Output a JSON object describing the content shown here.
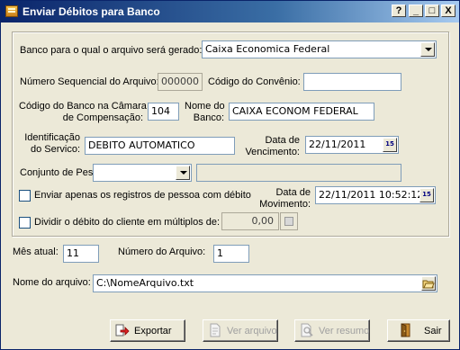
{
  "window": {
    "title": "Enviar Débitos para Banco",
    "controls": {
      "help": "?",
      "minimize": "_",
      "maximize": "□",
      "close": "X"
    }
  },
  "form": {
    "banco_label": "Banco para o qual o arquivo será gerado:",
    "banco_value": "Caixa Economica Federal",
    "sequencial_label": "Número Sequencial do Arquivo:",
    "sequencial_value": "000000",
    "convenio_label": "Código do Convênio:",
    "convenio_value": "",
    "codigo_banco_label_line1": "Código do Banco na Câmara",
    "codigo_banco_label_line2": "de Compensação:",
    "codigo_banco_value": "104",
    "nome_banco_label_line1": "Nome do",
    "nome_banco_label_line2": "Banco:",
    "nome_banco_value": "CAIXA ECONOM FEDERAL",
    "identificacao_label_line1": "Identificação",
    "identificacao_label_line2": "do Servico:",
    "identificacao_value": "DEBITO AUTOMATICO",
    "vencimento_label_line1": "Data de",
    "vencimento_label_line2": "Vencimento:",
    "vencimento_value": "22/11/2011",
    "conjunto_label": "Conjunto de Pessoas:",
    "conjunto_value": "",
    "conjunto_desc": "",
    "enviar_apenas_label": "Enviar apenas os registros de pessoa com débito",
    "enviar_apenas_checked": false,
    "movimento_label_line1": "Data de",
    "movimento_label_line2": "Movimento:",
    "movimento_value": "22/11/2011 10:52:12",
    "dividir_label": "Dividir o débito do cliente em múltiplos de:",
    "dividir_checked": false,
    "dividir_value": "0,00",
    "calendar_icon_text": "15"
  },
  "footer_fields": {
    "mes_label": "Mês atual:",
    "mes_value": "11",
    "numero_label": "Número do Arquivo:",
    "numero_value": "1",
    "nome_arquivo_label": "Nome do arquivo:",
    "nome_arquivo_value": "C:\\NomeArquivo.txt"
  },
  "buttons": {
    "exportar": "Exportar",
    "ver_arquivo": "Ver arquivo",
    "ver_resumo": "Ver resumo",
    "sair": "Sair"
  },
  "icons": {
    "app": "folder-icon",
    "exportar": "export-arrow-icon",
    "ver_arquivo": "document-icon",
    "ver_resumo": "magnifier-icon",
    "sair": "exit-door-icon",
    "open_folder": "open-folder-icon",
    "calendar": "calendar-icon",
    "calculator": "calculator-icon"
  },
  "colors": {
    "title_gradient_start": "#0A246A",
    "title_gradient_end": "#A6CAF0",
    "window_bg": "#ECE9D8",
    "field_border": "#7F9DB9"
  }
}
